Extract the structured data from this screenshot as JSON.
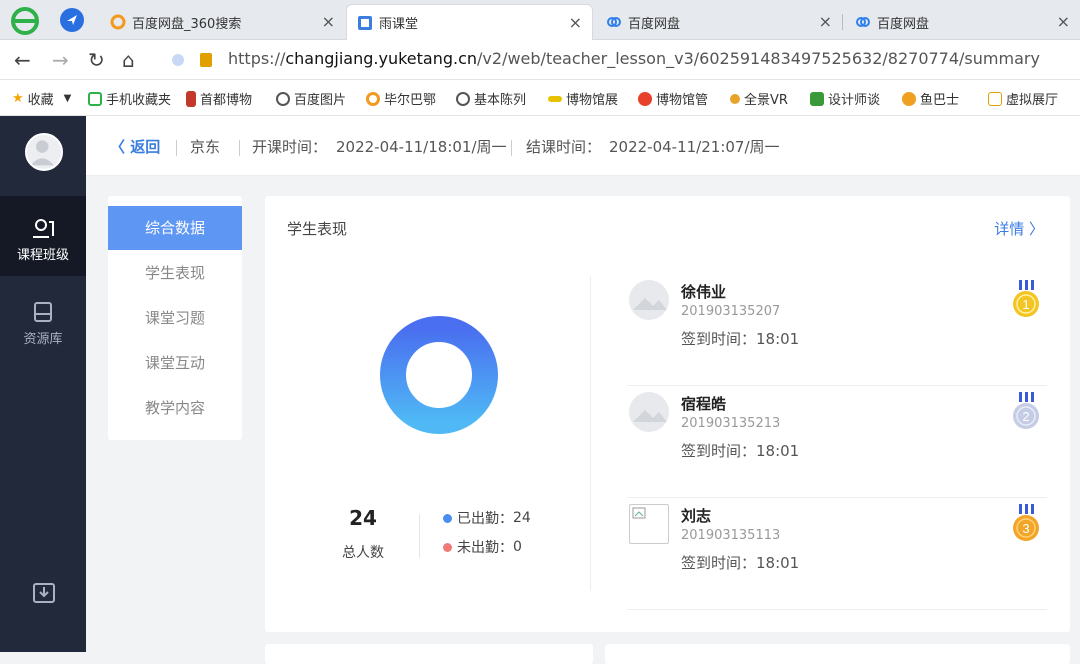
{
  "browser": {
    "tabs": [
      {
        "title": "百度网盘_360搜索",
        "close": "×"
      },
      {
        "title": "雨课堂",
        "close": "×"
      },
      {
        "title": "百度网盘",
        "close": "×"
      },
      {
        "title": "百度网盘",
        "close": "×"
      }
    ],
    "url_prefix": "https://",
    "url_host": "changjiang.yuketang.cn",
    "url_path": "/v2/web/teacher_lesson_v3/602591483497525632/8270774/summary",
    "bookmarks": [
      "收藏",
      "手机收藏夹",
      "首都博物",
      "百度图片",
      "毕尔巴鄂",
      "基本陈列",
      "博物馆展",
      "博物馆管",
      "全景VR",
      "设计师谈",
      "鱼巴士",
      "虚拟展厅"
    ]
  },
  "sidebar": {
    "items": [
      {
        "label": "课程班级",
        "icon": "class-icon"
      },
      {
        "label": "资源库",
        "icon": "library-icon"
      }
    ]
  },
  "topbar": {
    "back": "返回",
    "class_name": "京东",
    "start_label": "开课时间：",
    "start_value": "2022-04-11/18:01/周一",
    "end_label": "结课时间：",
    "end_value": "2022-04-11/21:07/周一"
  },
  "leftnav": {
    "items": [
      "综合数据",
      "学生表现",
      "课堂习题",
      "课堂互动",
      "教学内容"
    ]
  },
  "performance": {
    "title": "学生表现",
    "detail": "详情",
    "total": "24",
    "total_label": "总人数",
    "attended_label": "已出勤：",
    "attended_value": "24",
    "absent_label": "未出勤：",
    "absent_value": "0",
    "colors": {
      "attended": "#4a8ef0",
      "absent": "#f07a7a"
    },
    "students": [
      {
        "name": "徐伟业",
        "id": "201903135207",
        "checkin": "签到时间：18:01",
        "rank": "1"
      },
      {
        "name": "宿程皓",
        "id": "201903135213",
        "checkin": "签到时间：18:01",
        "rank": "2"
      },
      {
        "name": "刘志",
        "id": "201903135113",
        "checkin": "签到时间：18:01",
        "rank": "3"
      }
    ]
  }
}
